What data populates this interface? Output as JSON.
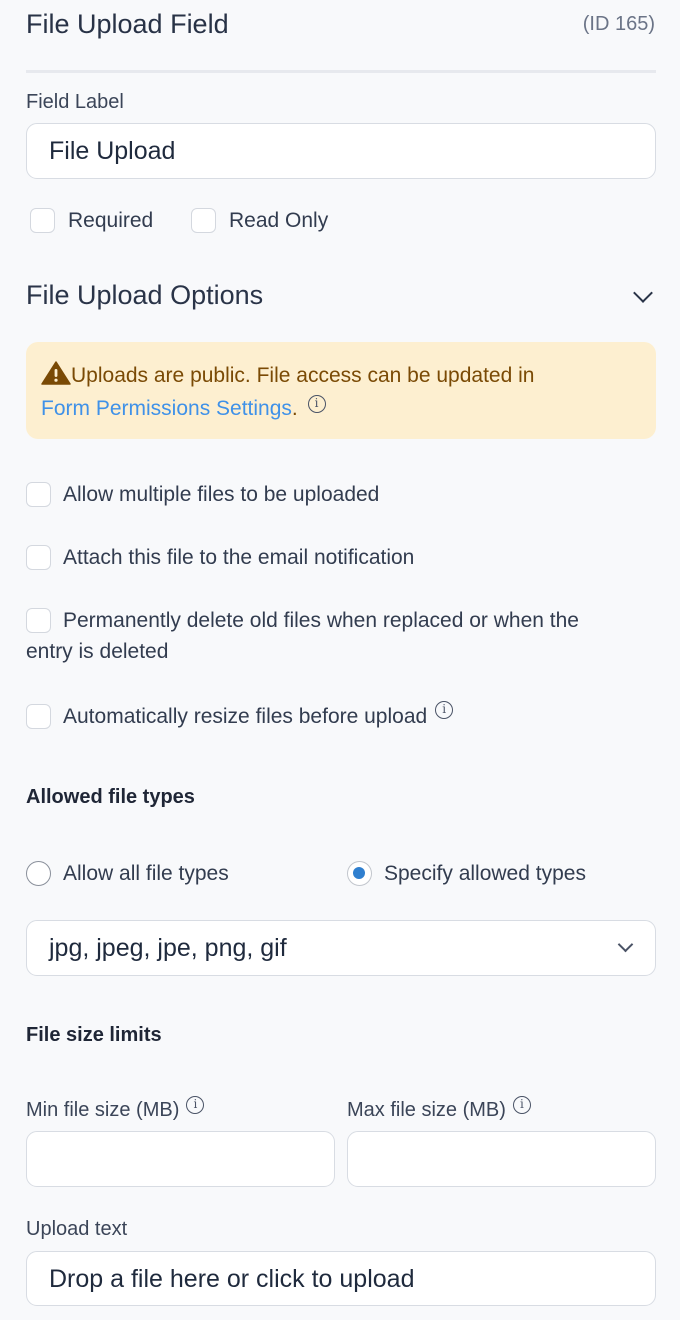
{
  "header": {
    "title": "File Upload Field",
    "id_label": "(ID 165)"
  },
  "field_label": {
    "label": "Field Label",
    "value": "File Upload"
  },
  "flags": {
    "required": {
      "label": "Required",
      "checked": false
    },
    "read_only": {
      "label": "Read Only",
      "checked": false
    }
  },
  "options_section": {
    "title": "File Upload Options",
    "expanded": true
  },
  "warning_banner": {
    "text": "Uploads are public. File access can be updated in",
    "link_text": "Form Permissions Settings",
    "suffix": ".",
    "colors": {
      "background": "#fdefd0",
      "text": "#7a4a05",
      "link": "#3f91e8"
    }
  },
  "options": [
    {
      "label": "Allow multiple files to be uploaded",
      "checked": false
    },
    {
      "label": "Attach this file to the email notification",
      "checked": false
    },
    {
      "label_line1": "Permanently delete old files when replaced or when the",
      "label_line2": "entry is deleted",
      "checked": false
    },
    {
      "label": "Automatically resize files before upload",
      "checked": false,
      "has_info": true
    }
  ],
  "allowed_types": {
    "heading": "Allowed file types",
    "radio_all": {
      "label": "Allow all file types",
      "selected": false
    },
    "radio_specify": {
      "label": "Specify allowed types",
      "selected": true
    },
    "selected_types": "jpg, jpeg, jpe, png, gif"
  },
  "size_limits": {
    "heading": "File size limits",
    "min_label": "Min file size (MB)",
    "min_value": "",
    "max_label": "Max file size (MB)",
    "max_value": ""
  },
  "upload_text": {
    "label": "Upload text",
    "value": "Drop a file here or click to upload"
  }
}
